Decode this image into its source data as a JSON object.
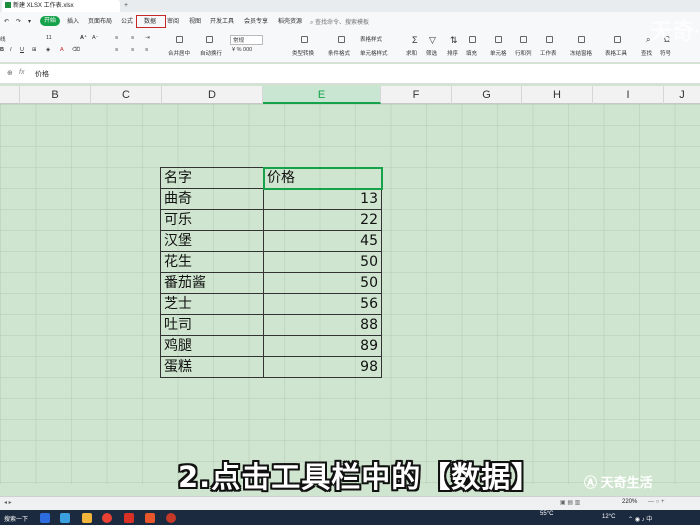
{
  "window": {
    "file_tab": "新建 XLSX 工作表.xlsx",
    "new_tab": "+"
  },
  "menu": {
    "start": "开始",
    "items": [
      "插入",
      "页面布局",
      "公式",
      "数据",
      "审阅",
      "视图",
      "开发工具",
      "会员专享",
      "稻壳资源"
    ],
    "search": "查找命令、搜索模板"
  },
  "ribbon": {
    "font_size": "11",
    "number_format": "常规",
    "labels": [
      "合并居中",
      "自动换行",
      "类型转换",
      "条件格式",
      "表格样式",
      "单元格样式",
      "求和",
      "筛选",
      "排序",
      "填充",
      "单元格",
      "行和列",
      "工作表",
      "冻结窗格",
      "表格工具",
      "查找",
      "符号"
    ]
  },
  "formula_bar": {
    "fx": "fx",
    "value": "价格"
  },
  "columns": [
    "B",
    "C",
    "D",
    "E",
    "F",
    "G",
    "H",
    "I",
    "J"
  ],
  "selected_column": "E",
  "table": {
    "header": {
      "name": "名字",
      "price": "价格"
    },
    "rows": [
      {
        "name": "曲奇",
        "price": "13"
      },
      {
        "name": "可乐",
        "price": "22"
      },
      {
        "name": "汉堡",
        "price": "45"
      },
      {
        "name": "花生",
        "price": "50"
      },
      {
        "name": "番茄酱",
        "price": "50"
      },
      {
        "name": "芝士",
        "price": "56"
      },
      {
        "name": "吐司",
        "price": "88"
      },
      {
        "name": "鸡腿",
        "price": "89"
      },
      {
        "name": "蛋糕",
        "price": "98"
      }
    ]
  },
  "subtitle": "2.点击工具栏中的【数据】",
  "watermark": {
    "top": "天奇·",
    "bottom": "天奇生活"
  },
  "statusbar": {
    "zoom": "220%"
  },
  "taskbar": {
    "start": "搜索一下",
    "temp": "12°C",
    "weather": "55°C"
  },
  "colors": {
    "accent": "#15a24b",
    "highlight_border": "#c62828",
    "grid_bg": "#cfe5cf"
  }
}
